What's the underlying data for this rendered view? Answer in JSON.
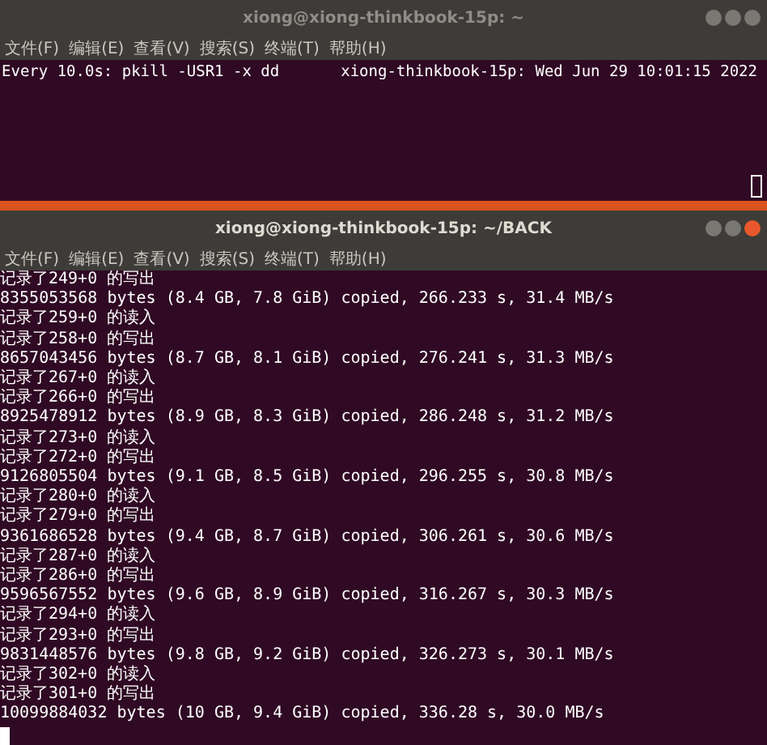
{
  "windows": [
    {
      "title": "xiong@xiong-thinkbook-15p: ~",
      "active": false,
      "menu": [
        "文件(F)",
        "编辑(E)",
        "查看(V)",
        "搜索(S)",
        "终端(T)",
        "帮助(H)"
      ],
      "header": {
        "command": "Every 10.0s: pkill -USR1 -x dd",
        "host_time": "xiong-thinkbook-15p: Wed Jun 29 10:01:15 2022"
      },
      "cursor_filled": false
    },
    {
      "title": "xiong@xiong-thinkbook-15p: ~/BACK",
      "active": true,
      "menu": [
        "文件(F)",
        "编辑(E)",
        "查看(V)",
        "搜索(S)",
        "终端(T)",
        "帮助(H)"
      ],
      "lines": [
        "记录了249+0 的写出",
        "8355053568 bytes (8.4 GB, 7.8 GiB) copied, 266.233 s, 31.4 MB/s",
        "记录了259+0 的读入",
        "记录了258+0 的写出",
        "8657043456 bytes (8.7 GB, 8.1 GiB) copied, 276.241 s, 31.3 MB/s",
        "记录了267+0 的读入",
        "记录了266+0 的写出",
        "8925478912 bytes (8.9 GB, 8.3 GiB) copied, 286.248 s, 31.2 MB/s",
        "记录了273+0 的读入",
        "记录了272+0 的写出",
        "9126805504 bytes (9.1 GB, 8.5 GiB) copied, 296.255 s, 30.8 MB/s",
        "记录了280+0 的读入",
        "记录了279+0 的写出",
        "9361686528 bytes (9.4 GB, 8.7 GiB) copied, 306.261 s, 30.6 MB/s",
        "记录了287+0 的读入",
        "记录了286+0 的写出",
        "9596567552 bytes (9.6 GB, 8.9 GiB) copied, 316.267 s, 30.3 MB/s",
        "记录了294+0 的读入",
        "记录了293+0 的写出",
        "9831448576 bytes (9.8 GB, 9.2 GiB) copied, 326.273 s, 30.1 MB/s",
        "记录了302+0 的读入",
        "记录了301+0 的写出",
        "10099884032 bytes (10 GB, 9.4 GiB) copied, 336.28 s, 30.0 MB/s"
      ],
      "cursor_filled": true
    }
  ]
}
